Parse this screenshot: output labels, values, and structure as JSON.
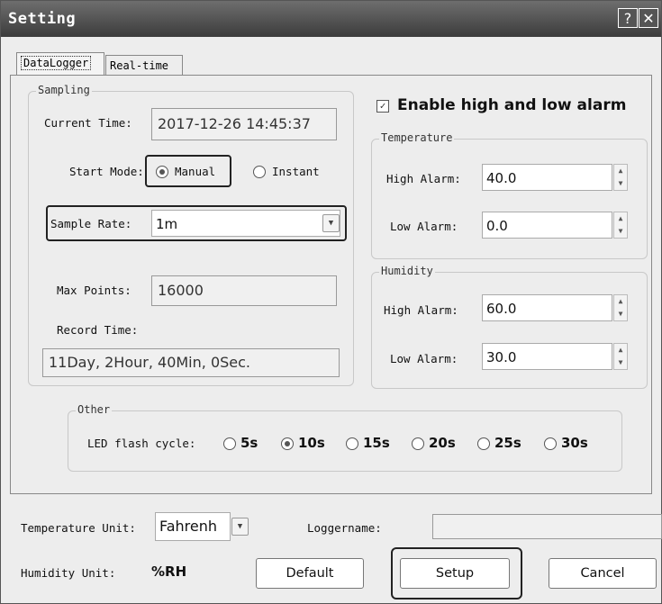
{
  "window": {
    "title": "Setting",
    "help_label": "?",
    "close_label": "✕"
  },
  "tabs": [
    {
      "label": "DataLogger",
      "active": true
    },
    {
      "label": "Real-time",
      "active": false
    }
  ],
  "sampling": {
    "legend": "Sampling",
    "current_time_label": "Current Time:",
    "current_time_value": "2017-12-26 14:45:37",
    "start_mode_label": "Start Mode:",
    "start_mode_options": [
      "Manual",
      "Instant"
    ],
    "start_mode_selected": "Manual",
    "sample_rate_label": "Sample Rate:",
    "sample_rate_value": "1m",
    "max_points_label": "Max Points:",
    "max_points_value": "16000",
    "record_time_label": "Record Time:",
    "record_time_value": "11Day, 2Hour, 40Min, 0Sec."
  },
  "alarm": {
    "enable_label": "Enable high and low alarm",
    "enabled": true,
    "temperature": {
      "legend": "Temperature",
      "high_label": "High Alarm:",
      "high_value": "40.0",
      "low_label": "Low Alarm:",
      "low_value": "0.0"
    },
    "humidity": {
      "legend": "Humidity",
      "high_label": "High Alarm:",
      "high_value": "60.0",
      "low_label": "Low Alarm:",
      "low_value": "30.0"
    }
  },
  "other": {
    "legend": "Other",
    "led_label": "LED flash cycle:",
    "led_options": [
      "5s",
      "10s",
      "15s",
      "20s",
      "25s",
      "30s"
    ],
    "led_selected": "10s"
  },
  "bottom": {
    "temp_unit_label": "Temperature Unit:",
    "temp_unit_value": "Fahrenh",
    "loggername_label": "Loggername:",
    "loggername_value": "",
    "humidity_unit_label": "Humidity Unit:",
    "humidity_unit_value": "%RH",
    "default_label": "Default",
    "setup_label": "Setup",
    "cancel_label": "Cancel"
  }
}
